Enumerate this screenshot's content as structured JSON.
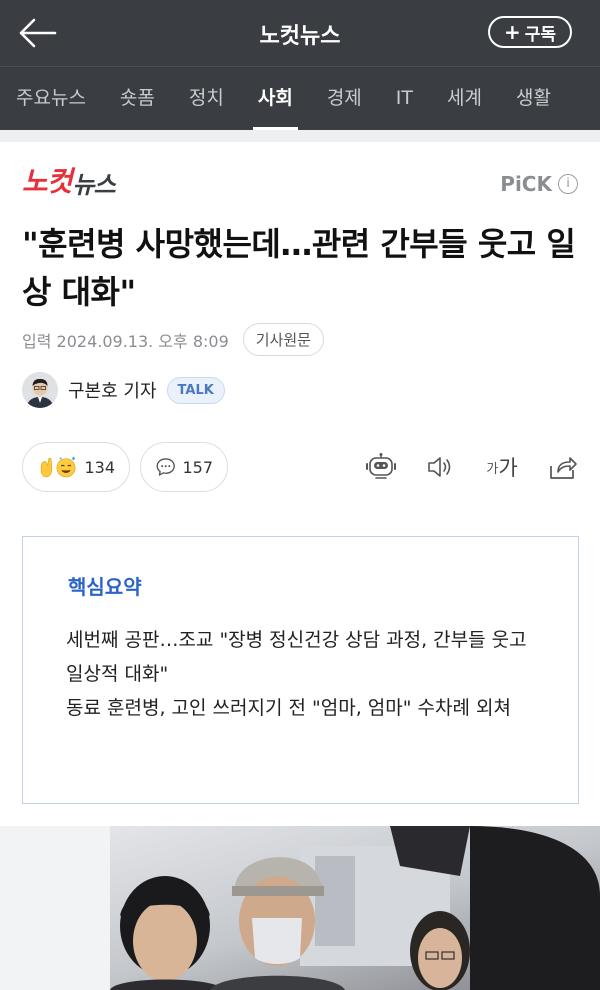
{
  "header": {
    "title": "노컷뉴스",
    "subscribe_plus": "+",
    "subscribe_label": "구독"
  },
  "tabs": [
    {
      "label": "주요뉴스",
      "active": false
    },
    {
      "label": "숏폼",
      "active": false
    },
    {
      "label": "정치",
      "active": false
    },
    {
      "label": "사회",
      "active": true
    },
    {
      "label": "경제",
      "active": false
    },
    {
      "label": "IT",
      "active": false
    },
    {
      "label": "세계",
      "active": false
    },
    {
      "label": "생활",
      "active": false
    }
  ],
  "press": {
    "logo_part1": "노컷",
    "logo_part2": "뉴스",
    "pick_label": "PiCK",
    "pick_info": "i"
  },
  "article": {
    "headline": "\"훈련병 사망했는데…관련 간부들 웃고 일상 대화\"",
    "date": "입력 2024.09.13. 오후 8:09",
    "original_label": "기사원문",
    "reporter_name": "구본호 기자",
    "talk_label": "TALK",
    "reaction_count": "134",
    "comment_count": "157",
    "font_small": "가",
    "font_large": "가"
  },
  "summary": {
    "title": "핵심요약",
    "line1": "세번째 공판…조교 \"장병 정신건강 상담 과정, 간부들 웃고 일상적 대화\"",
    "line2": "동료 훈련병, 고인 쓰러지기 전 \"엄마, 엄마\" 수차례 외쳐"
  },
  "icons": {
    "back": "arrow-left-icon",
    "reaction": "clap-emoji-icon",
    "comment": "speech-bubble-icon",
    "bot": "robot-icon",
    "tts": "speaker-icon",
    "share": "share-icon"
  },
  "colors": {
    "header_bg": "#3a3d42",
    "brand_red": "#e8303a",
    "summary_title": "#2a64c8",
    "summary_border": "#c3d2e4"
  }
}
